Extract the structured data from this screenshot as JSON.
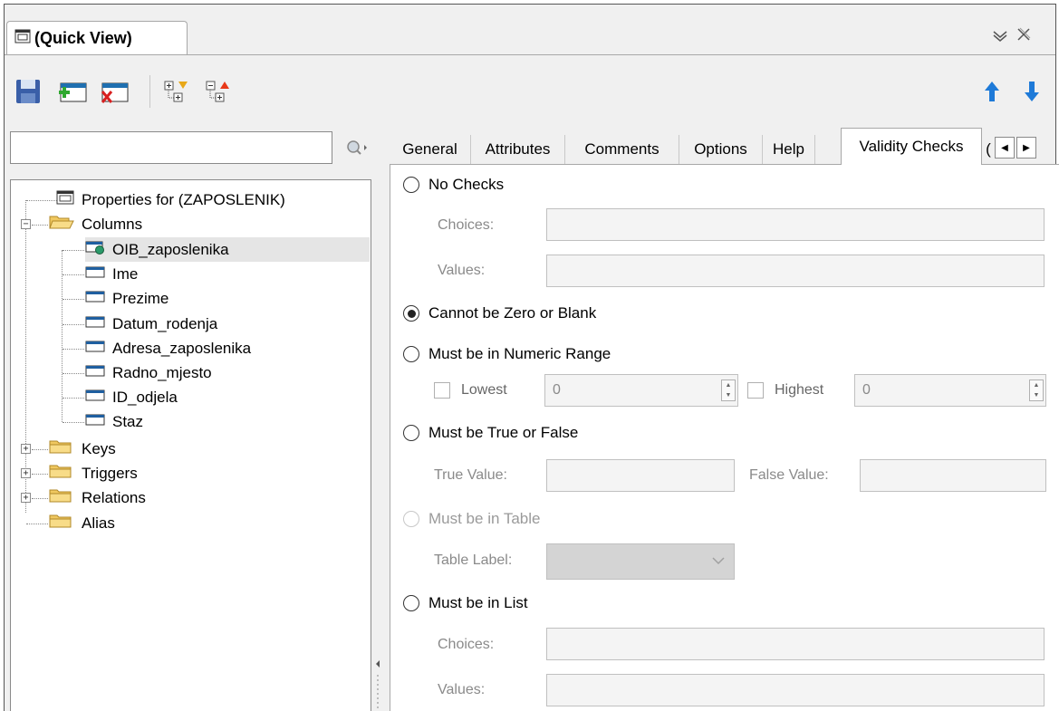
{
  "window": {
    "title": "(Quick View)",
    "controls": [
      "chevron-down-icon",
      "close-icon"
    ]
  },
  "toolbar": {
    "buttons": [
      "save-icon",
      "add-row-icon",
      "delete-row-icon",
      "expand-tree-icon",
      "collapse-tree-icon"
    ],
    "move_up": "arrow-up-icon",
    "move_down": "arrow-down-icon"
  },
  "search": {
    "value": "",
    "placeholder": ""
  },
  "tree": {
    "properties": "Properties for (ZAPOSLENIK)",
    "columns_label": "Columns",
    "columns": [
      "OIB_zaposlenika",
      "Ime",
      "Prezime",
      "Datum_rodenja",
      "Adresa_zaposlenika",
      "Radno_mjesto",
      "ID_odjela",
      "Staz"
    ],
    "selected": "OIB_zaposlenika",
    "keys": "Keys",
    "triggers": "Triggers",
    "relations": "Relations",
    "alias": "Alias"
  },
  "tabs": {
    "general": "General",
    "attributes": "Attributes",
    "comments": "Comments",
    "options": "Options",
    "help": "Help",
    "validity": "Validity Checks",
    "partial": "("
  },
  "validity": {
    "no_checks": "No Checks",
    "choices_label": "Choices:",
    "values_label": "Values:",
    "not_zero": "Cannot be Zero or Blank",
    "numeric_range": "Must be in Numeric Range",
    "lowest_label": "Lowest",
    "lowest_value": "0",
    "highest_label": "Highest",
    "highest_value": "0",
    "true_false": "Must be True or False",
    "true_value_label": "True Value:",
    "false_value_label": "False Value:",
    "in_table": "Must be in Table",
    "table_label": "Table Label:",
    "in_list": "Must be in List",
    "list_choices_label": "Choices:",
    "list_values_label": "Values:",
    "selected_option": "Cannot be Zero or Blank"
  }
}
